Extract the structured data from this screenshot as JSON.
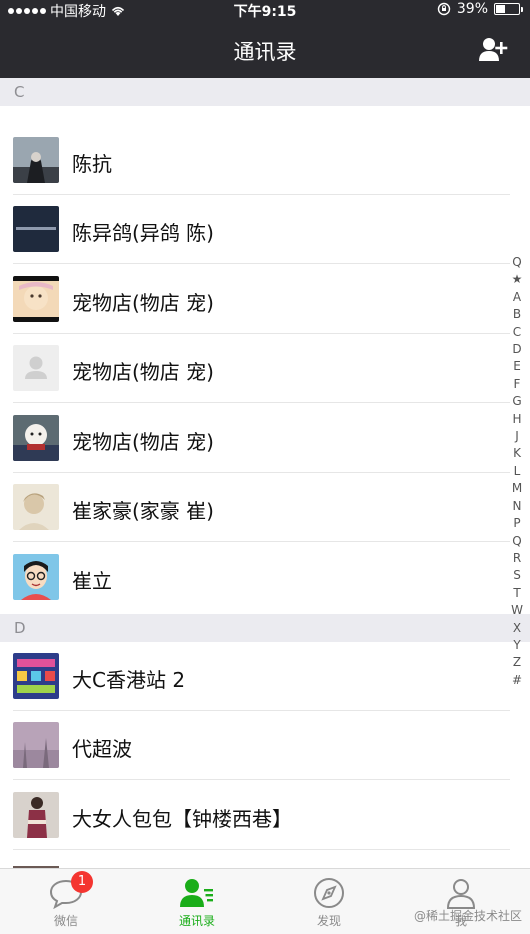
{
  "status_bar": {
    "carrier": "中国移动",
    "time": "下午9:15",
    "battery": "39%",
    "battery_level": 0.39
  },
  "nav": {
    "title": "通讯录"
  },
  "sections": [
    {
      "letter": "C"
    },
    {
      "letter": "D"
    }
  ],
  "contacts_c": [
    {
      "name": "陈抗",
      "avatar": "dark-figure"
    },
    {
      "name": "陈异鸽(异鸽 陈)",
      "avatar": "navy-text"
    },
    {
      "name": "宠物店(物店 宠)",
      "avatar": "baby-photo"
    },
    {
      "name": "宠物店(物店 宠)",
      "avatar": "default-silhouette"
    },
    {
      "name": "宠物店(物店 宠)",
      "avatar": "dog-photo"
    },
    {
      "name": "崔家豪(家豪 崔)",
      "avatar": "soft-portrait"
    },
    {
      "name": "崔立",
      "avatar": "cartoon-face"
    }
  ],
  "contacts_d": [
    {
      "name": "大C香港站 2",
      "avatar": "colorful-poster"
    },
    {
      "name": "代超波",
      "avatar": "purple-haze"
    },
    {
      "name": "大女人包包【钟楼西巷】",
      "avatar": "fashion-photo"
    }
  ],
  "index_bar": [
    "Q",
    "★",
    "A",
    "B",
    "C",
    "D",
    "E",
    "F",
    "G",
    "H",
    "J",
    "K",
    "L",
    "M",
    "N",
    "P",
    "Q",
    "R",
    "S",
    "T",
    "W",
    "X",
    "Y",
    "Z",
    "#"
  ],
  "tabs": [
    {
      "label": "微信",
      "badge": "1"
    },
    {
      "label": "通讯录"
    },
    {
      "label": "发现"
    },
    {
      "label": "我"
    }
  ],
  "watermark": "@稀土掘金技术社区",
  "colors": {
    "nav_bg": "#2a2a2f",
    "active_tab": "#1aad19",
    "badge": "#f43530",
    "section_bg": "#ebebf0"
  }
}
